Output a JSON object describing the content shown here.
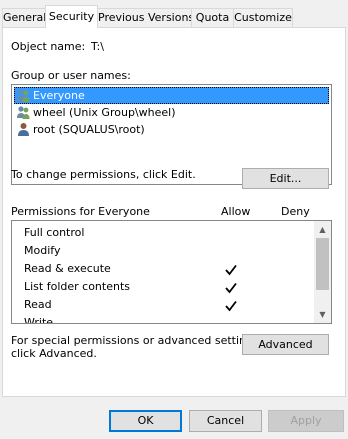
{
  "tabs": [
    {
      "label": "General"
    },
    {
      "label": "Security"
    },
    {
      "label": "Previous Versions"
    },
    {
      "label": "Quota"
    },
    {
      "label": "Customize"
    }
  ],
  "object": {
    "label": "Object name:",
    "value": "T:\\"
  },
  "group_label": "Group or user names:",
  "users": [
    {
      "name": "Everyone",
      "icon": "group-icon"
    },
    {
      "name": "wheel (Unix Group\\wheel)",
      "icon": "group-icon"
    },
    {
      "name": "root (SQUALUS\\root)",
      "icon": "user-icon"
    }
  ],
  "change_text": "To change permissions, click Edit.",
  "edit_label": "Edit...",
  "permissions": {
    "header": "Permissions for Everyone",
    "allow_header": "Allow",
    "deny_header": "Deny",
    "rows": [
      {
        "name": "Full control",
        "allow": false,
        "deny": false
      },
      {
        "name": "Modify",
        "allow": false,
        "deny": false
      },
      {
        "name": "Read & execute",
        "allow": true,
        "deny": false
      },
      {
        "name": "List folder contents",
        "allow": true,
        "deny": false
      },
      {
        "name": "Read",
        "allow": true,
        "deny": false
      },
      {
        "name": "Write",
        "allow": false,
        "deny": false
      }
    ]
  },
  "advanced_text_line1": "For special permissions or advanced settings,",
  "advanced_text_line2": "click Advanced.",
  "advanced_label": "Advanced",
  "footer": {
    "ok": "OK",
    "cancel": "Cancel",
    "apply": "Apply"
  },
  "colors": {
    "selection": "#3399ff",
    "default_button_border": "#0078d7"
  }
}
